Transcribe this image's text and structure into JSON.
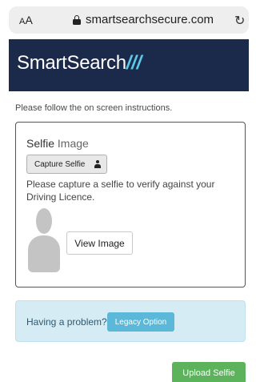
{
  "browser": {
    "text_size_small": "A",
    "text_size_large": "A",
    "url": "smartsearchsecure.com"
  },
  "brand": {
    "name": "SmartSearch",
    "slashes": "///",
    "bg_color": "#1b2a4a",
    "accent_color": "#5ec8e8"
  },
  "page": {
    "intro": "Please follow the on screen instructions."
  },
  "selfie_card": {
    "title_bold": "Selfie",
    "title_rest": " Image",
    "capture_label": "Capture Selfie",
    "description": "Please capture a selfie to verify against your Driving Licence.",
    "view_label": "View Image"
  },
  "help": {
    "question": "Having a problem?",
    "legacy_label": "Legacy Option"
  },
  "actions": {
    "upload_label": "Upload Selfie",
    "upload_color": "#5cb35c"
  }
}
